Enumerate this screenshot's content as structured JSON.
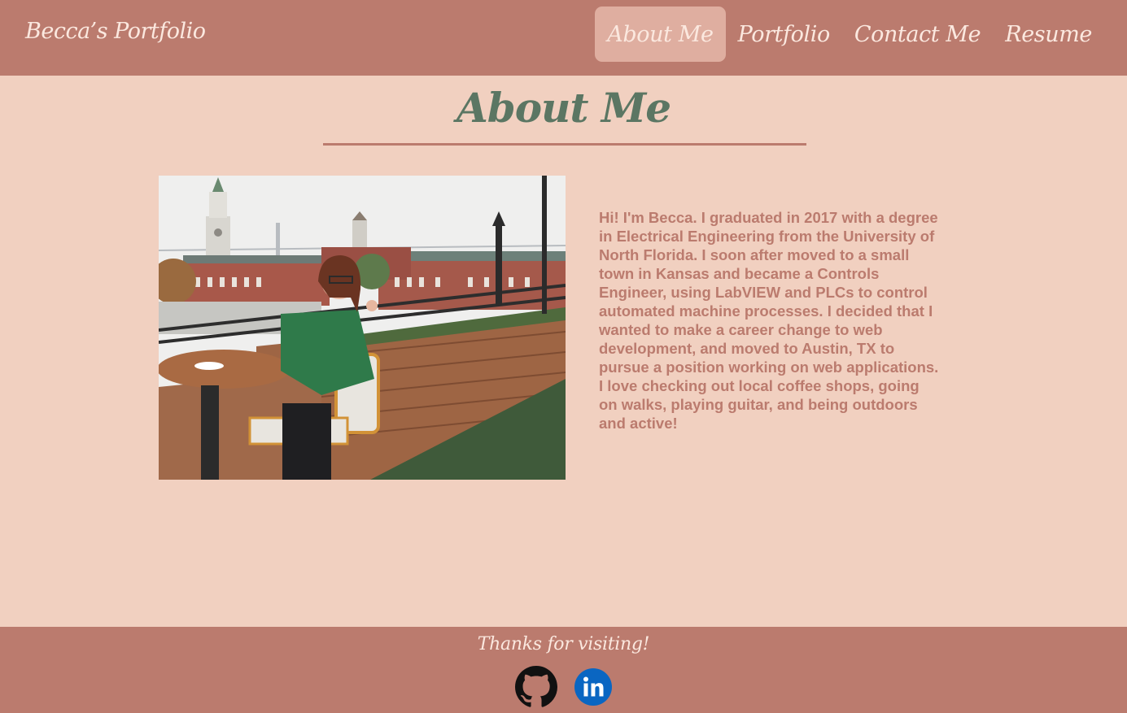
{
  "header": {
    "brand": "Becca’s Portfolio",
    "nav": [
      {
        "label": "About Me",
        "active": true
      },
      {
        "label": "Portfolio",
        "active": false
      },
      {
        "label": "Contact Me",
        "active": false
      },
      {
        "label": "Resume",
        "active": false
      }
    ]
  },
  "main": {
    "title": "About Me",
    "bio": "Hi! I'm Becca. I graduated in 2017 with a degree in Electrical Engineering from the University of North Florida. I soon after moved to a small town in Kansas and became a Controls Engineer, using LabVIEW and PLCs to control automated machine processes. I decided that I wanted to make a career change to web development, and moved to Austin, TX to pursue a position working on web applications. I love checking out local coffee shops, going on walks, playing guitar, and being outdoors and active!"
  },
  "footer": {
    "thanks": "Thanks for visiting!",
    "social": [
      {
        "icon": "github-icon"
      },
      {
        "icon": "linkedin-icon"
      }
    ]
  },
  "colors": {
    "header_bg": "#bb7b6e",
    "page_bg": "#f1d0c0",
    "title_green": "#5b7663",
    "active_tab": "#dfaea0",
    "linkedin_blue": "#0a66c2"
  }
}
